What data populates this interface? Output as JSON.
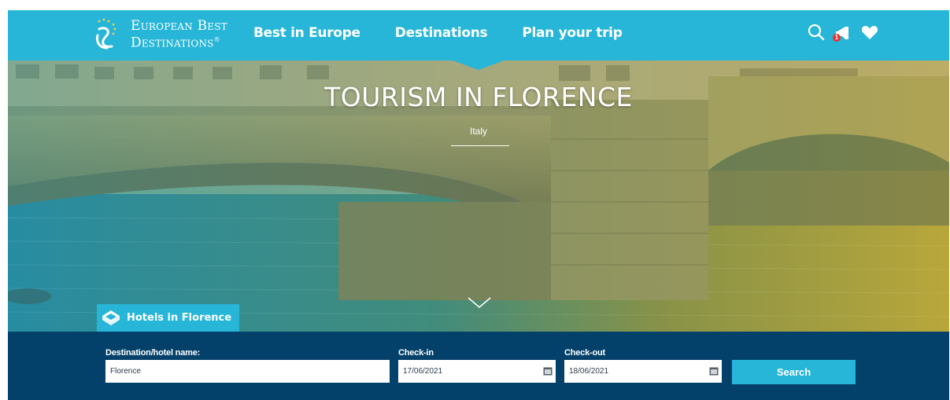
{
  "header": {
    "logo_line1": "European Best",
    "logo_line2": "Destinations",
    "logo_reg": "®",
    "nav": [
      "Best in Europe",
      "Destinations",
      "Plan your trip"
    ],
    "notification_count": "1"
  },
  "hero": {
    "title": "TOURISM IN FLORENCE",
    "subtitle": "Italy"
  },
  "hotels_tab": {
    "label": "Hotels in Florence"
  },
  "search": {
    "destination_label": "Destination/hotel name:",
    "destination_value": "Florence",
    "checkin_label": "Check-in",
    "checkin_value": "17/06/2021",
    "checkout_label": "Check-out",
    "checkout_value": "18/06/2021",
    "button_label": "Search"
  },
  "colors": {
    "accent": "#27b6d8",
    "searchbar": "#04416a"
  },
  "icons": [
    "logo-mark",
    "search-icon",
    "notification-icon",
    "heart-icon",
    "chevron-down-icon",
    "bed-icon",
    "calendar-icon"
  ]
}
